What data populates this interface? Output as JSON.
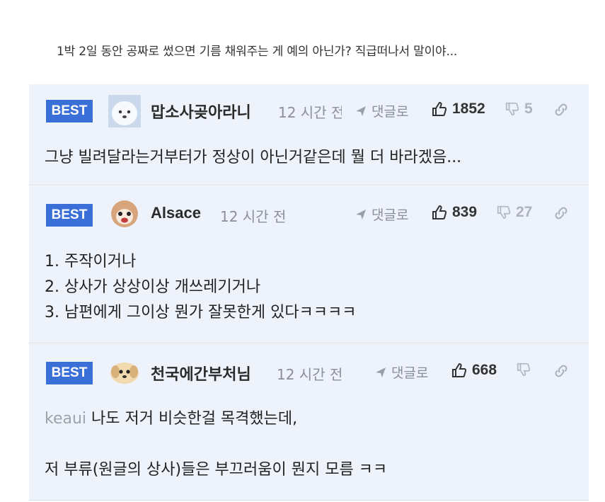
{
  "post": {
    "snippet": "1박 2일 동안 공짜로 썼으면 기름 채워주는 게 예의 아닌가? 직급떠나서 말이야..."
  },
  "comments": [
    {
      "badge": "BEST",
      "nickname": "맙소사곶아라니",
      "time": "12 시간 전",
      "reply_label": "댓글로",
      "upvotes": "1852",
      "downvotes": "5",
      "lines": [
        "그냥 빌려달라는거부터가 정상이 아닌거같은데 뭘 더 바라겠음..."
      ]
    },
    {
      "badge": "BEST",
      "nickname": "Alsace",
      "time": "12 시간 전",
      "reply_label": "댓글로",
      "upvotes": "839",
      "downvotes": "27",
      "lines": [
        "1. 주작이거나",
        "2. 상사가 상상이상 개쓰레기거나",
        "3. 남편에게 그이상 뭔가 잘못한게 있다ㅋㅋㅋㅋ"
      ]
    },
    {
      "badge": "BEST",
      "nickname": "천국에간부처님",
      "time": "12 시간 전",
      "reply_label": "댓글로",
      "upvotes": "668",
      "downvotes": "",
      "mention": "keaui",
      "lines": [
        "나도 저거 비슷한걸 목격했는데,",
        "저 부류(원글의 상사)들은 부끄러움이 뭔지 모름 ㅋㅋ"
      ]
    }
  ],
  "icons": {
    "reply": "reply-arrow-icon",
    "like": "thumbs-up-icon",
    "dislike": "thumbs-down-icon",
    "link": "link-icon"
  },
  "colors": {
    "badge": "#3b6fd8",
    "card_bg": "#eef2fb",
    "muted": "#8b8f98"
  }
}
